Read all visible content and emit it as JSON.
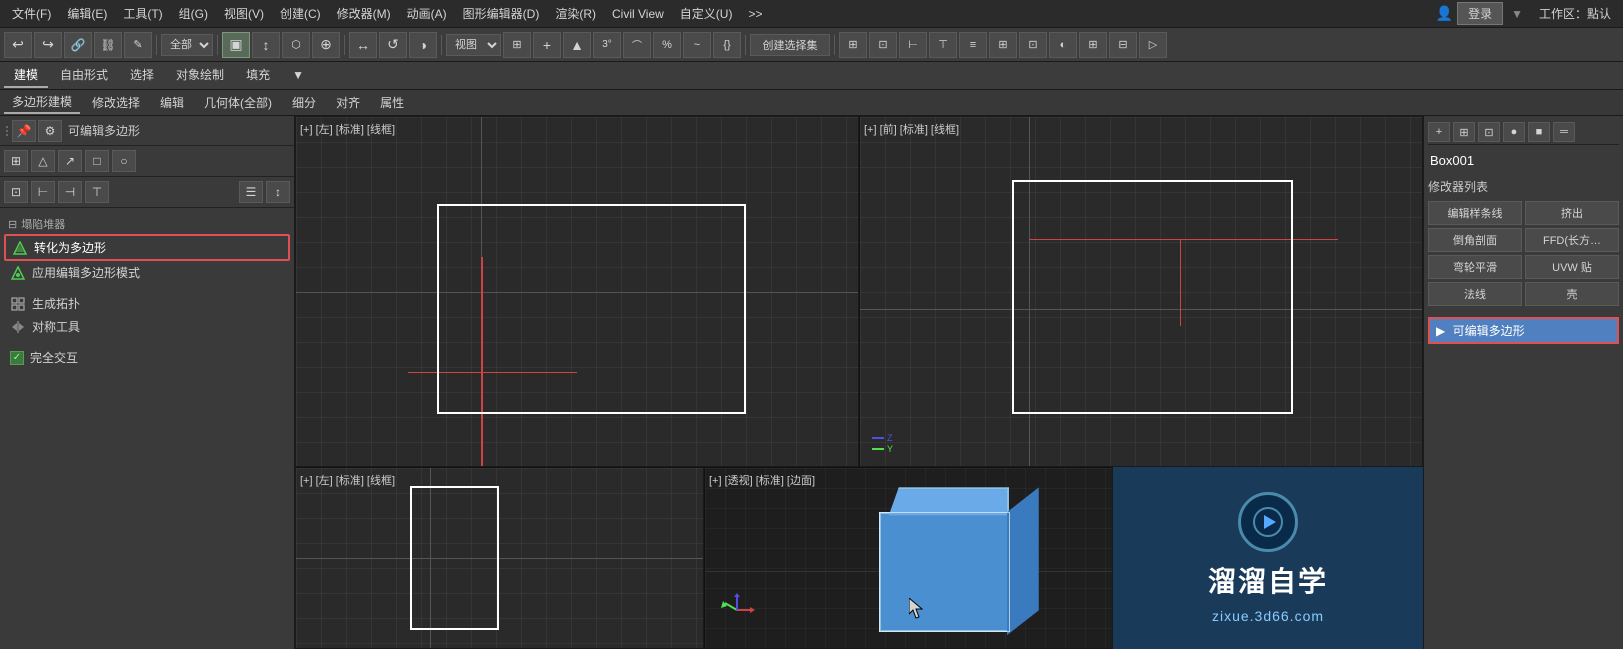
{
  "menubar": {
    "items": [
      "文件(F)",
      "编辑(E)",
      "工具(T)",
      "组(G)",
      "视图(V)",
      "创建(C)",
      "修改器(M)",
      "动画(A)",
      "图形编辑器(D)",
      "渲染(R)",
      "Civil View",
      "自定义(U)",
      ">>"
    ],
    "login": "登录",
    "workspace_label": "工作区：點认"
  },
  "toolbar": {
    "undo": "↩",
    "redo": "↪",
    "link": "🔗",
    "unlink": "⛓",
    "all_dropdown": "全部",
    "create_set": "创建选择集",
    "toolbar_icons": [
      "⊞",
      "↕",
      "⬡",
      "⊕",
      "↺",
      "◑",
      "视图",
      "⊞",
      "+",
      "▲",
      "3°",
      "⌒",
      "%",
      "~",
      "{}",
      ""
    ]
  },
  "secondary_tabs": {
    "tabs": [
      "建模",
      "自由形式",
      "选择",
      "对象绘制",
      "填充",
      "▼"
    ]
  },
  "tertiary_tabs": {
    "tabs": [
      "多边形建模",
      "修改选择",
      "编辑",
      "几何体(全部)",
      "细分",
      "对齐",
      "属性"
    ]
  },
  "left_panel": {
    "top_icons": [
      "≡",
      "≡",
      "≡",
      "≡",
      "≡"
    ],
    "title": "可编辑多边形",
    "icons_row": [
      "⊞",
      "△",
      "↗",
      "□",
      "○"
    ],
    "icons_row2": [
      "⊡",
      "⊢",
      "⊣",
      "⊤"
    ],
    "section_collapse": "塌陷堆器",
    "convert_to_poly": "转化为多边形",
    "apply_edit_poly": "应用编辑多边形模式",
    "generate_topo": "生成拓扑",
    "symmetry_tool": "对称工具",
    "full_interactive": "完全交互",
    "checkbox_checked": "✓"
  },
  "viewports": {
    "top_left_label": "[+] [左] [标准] [线框]",
    "top_right_label": "[+] [前] [标准] [线框]",
    "bottom_left_label": "[+] [左] [标准] [线框]",
    "bottom_right_label": "[+] [透视] [标准] [边面]"
  },
  "right_panel": {
    "obj_name": "Box001",
    "mod_list_label": "修改器列表",
    "btn1": "编辑样条线",
    "btn2": "挤出",
    "btn3": "倒角剖面",
    "btn4": "FFD(长方…",
    "btn5": "弯轮平滑",
    "btn6": "UVW 贴",
    "btn7": "法线",
    "btn8": "壳",
    "active_mod": "可编辑多边形",
    "icons": [
      "+",
      "⊞",
      "⊡",
      "●",
      "■",
      "═"
    ]
  },
  "watermark": {
    "logo_icon": "▶",
    "title": "溜溜自学",
    "url": "zixue.3d66.com"
  }
}
